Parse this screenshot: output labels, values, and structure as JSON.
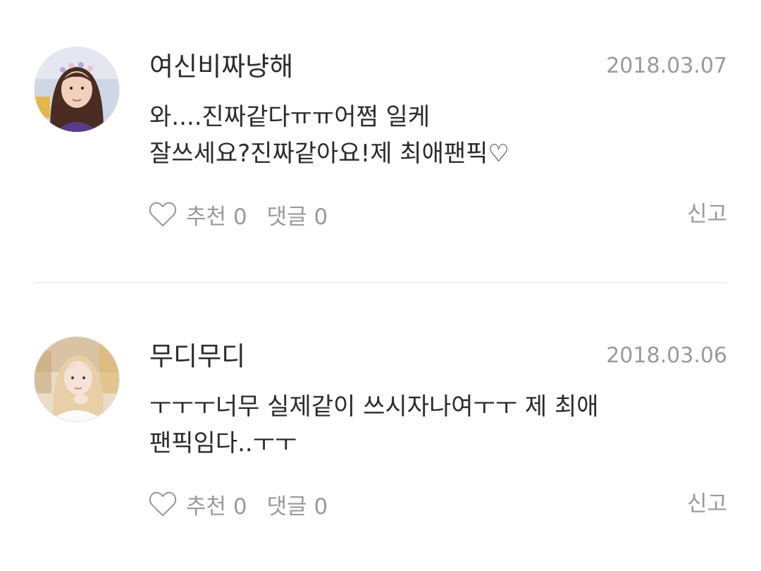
{
  "comments": [
    {
      "username": "여신비짜냥해",
      "date": "2018.03.07",
      "body_lines": [
        "와....진짜같다ㅠㅠ어쩜 일케",
        "잘쓰세요?진짜같아요!제 최애팬픽♡"
      ],
      "like_label": "추천 0",
      "reply_label": "댓글 0",
      "report_label": "신고"
    },
    {
      "username": "무디무디",
      "date": "2018.03.06",
      "body_lines": [
        "ㅜㅜㅜ너무 실제같이 쓰시자나여ㅜㅜ 제 최애",
        "팬픽임다..ㅜㅜ"
      ],
      "like_label": "추천 0",
      "reply_label": "댓글 0",
      "report_label": "신고"
    }
  ],
  "icons": {
    "like": "heart-outline-icon"
  },
  "colors": {
    "text": "#2b2b2b",
    "muted": "#9a9a9a",
    "divider": "#ececec"
  }
}
